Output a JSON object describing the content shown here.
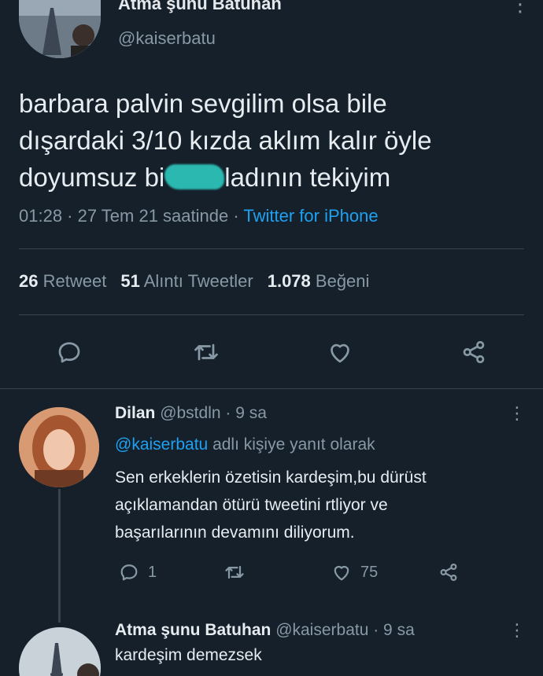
{
  "main_tweet": {
    "author_name": "Atma şunu Batuhan",
    "handle": "@kaiserbatu",
    "text_lines": [
      "barbara palvin sevgilim olsa bile",
      "dışardaki 3/10 kızda aklım kalır öyle"
    ],
    "text_line3_start": "doyumsuz bi",
    "text_line3_end": "ladının tekiyim",
    "time": "01:28 · 27 Tem 21 saatinde ·",
    "source": "Twitter for iPhone",
    "stats": {
      "retweets_count": "26",
      "retweets_label": "Retweet",
      "quotes_count": "51",
      "quotes_label": "Alıntı Tweetler",
      "likes_count": "1.078",
      "likes_label": "Beğeni"
    }
  },
  "reply": {
    "author_name": "Dilan",
    "handle_time": "@bstdln · 9 sa",
    "reply_to_mention": "@kaiserbatu",
    "reply_to_suffix": "adlı kişiye yanıt olarak",
    "text_lines": [
      "Sen erkeklerin özetisin kardeşim,bu dürüst",
      "açıklamandan ötürü tweetini rtliyor ve",
      "başarılarının devamını diliyorum."
    ],
    "reply_count": "1",
    "like_count": "75"
  },
  "reply2": {
    "author_name": "Atma şunu Batuhan",
    "handle_time": "@kaiserbatu · 9 sa",
    "text": "kardeşim demezsek"
  },
  "icons": {
    "reply": "comment-bubble-icon",
    "retweet": "retweet-arrows-icon",
    "like": "heart-icon",
    "share": "share-nodes-icon",
    "more": "vertical-dots-icon"
  },
  "colors": {
    "background": "#15202b",
    "accent": "#1da1f2",
    "muted": "#8899a6",
    "text": "#e7ecf0",
    "censor_blob": "#2bb8b0"
  }
}
